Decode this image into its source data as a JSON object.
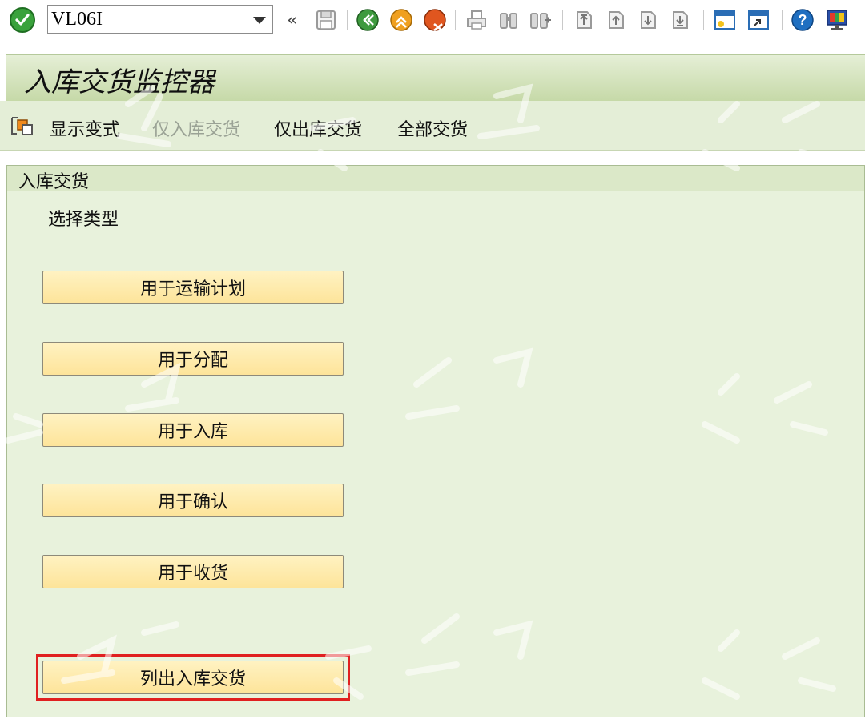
{
  "toolbar": {
    "command_value": "VL06I",
    "icons": [
      "enter-check-icon",
      "save-icon",
      "back-icon",
      "exit-icon",
      "cancel-icon",
      "print-icon",
      "find-icon",
      "find-next-icon",
      "first-page-icon",
      "previous-page-icon",
      "next-page-icon",
      "last-page-icon",
      "new-session-icon",
      "shortcut-icon",
      "help-icon",
      "customize-layout-icon"
    ],
    "history_glyph": "«"
  },
  "title": "入库交货监控器",
  "app_toolbar": {
    "items": [
      {
        "label": "显示变式",
        "enabled": true
      },
      {
        "label": "仅入库交货",
        "enabled": false
      },
      {
        "label": "仅出库交货",
        "enabled": true
      },
      {
        "label": "全部交货",
        "enabled": true
      }
    ]
  },
  "group": {
    "header": "入库交货",
    "subtitle": "选择类型",
    "buttons": [
      {
        "label": "用于运输计划"
      },
      {
        "label": "用于分配"
      },
      {
        "label": "用于入库"
      },
      {
        "label": "用于确认"
      },
      {
        "label": "用于收货"
      },
      {
        "label": "列出入库交货",
        "highlighted": true
      }
    ]
  },
  "colors": {
    "title_bg": "#c6d9a8",
    "content_bg": "#e8f2dc",
    "button_bg": "#fde49a",
    "highlight": "#e02020",
    "ok_green": "#3aa23c"
  }
}
